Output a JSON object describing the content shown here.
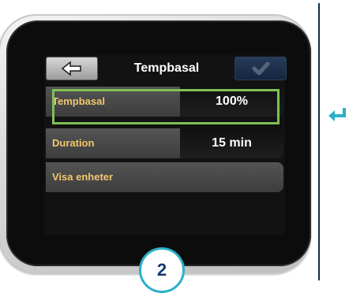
{
  "header": {
    "title": "Tempbasal",
    "back_icon": "arrow-left-icon",
    "confirm_icon": "checkmark-icon"
  },
  "rows": [
    {
      "label": "Tempbasal",
      "value": "100%"
    },
    {
      "label": "Duration",
      "value": "15 min"
    },
    {
      "label": "Visa enheter"
    }
  ],
  "step_number": "2",
  "side_icon": "return-arrow-icon",
  "colors": {
    "highlight": "#7ec155",
    "label_text": "#f1c76d",
    "step_ring": "#2cb0c8",
    "return_arrow": "#2cb0c8"
  }
}
